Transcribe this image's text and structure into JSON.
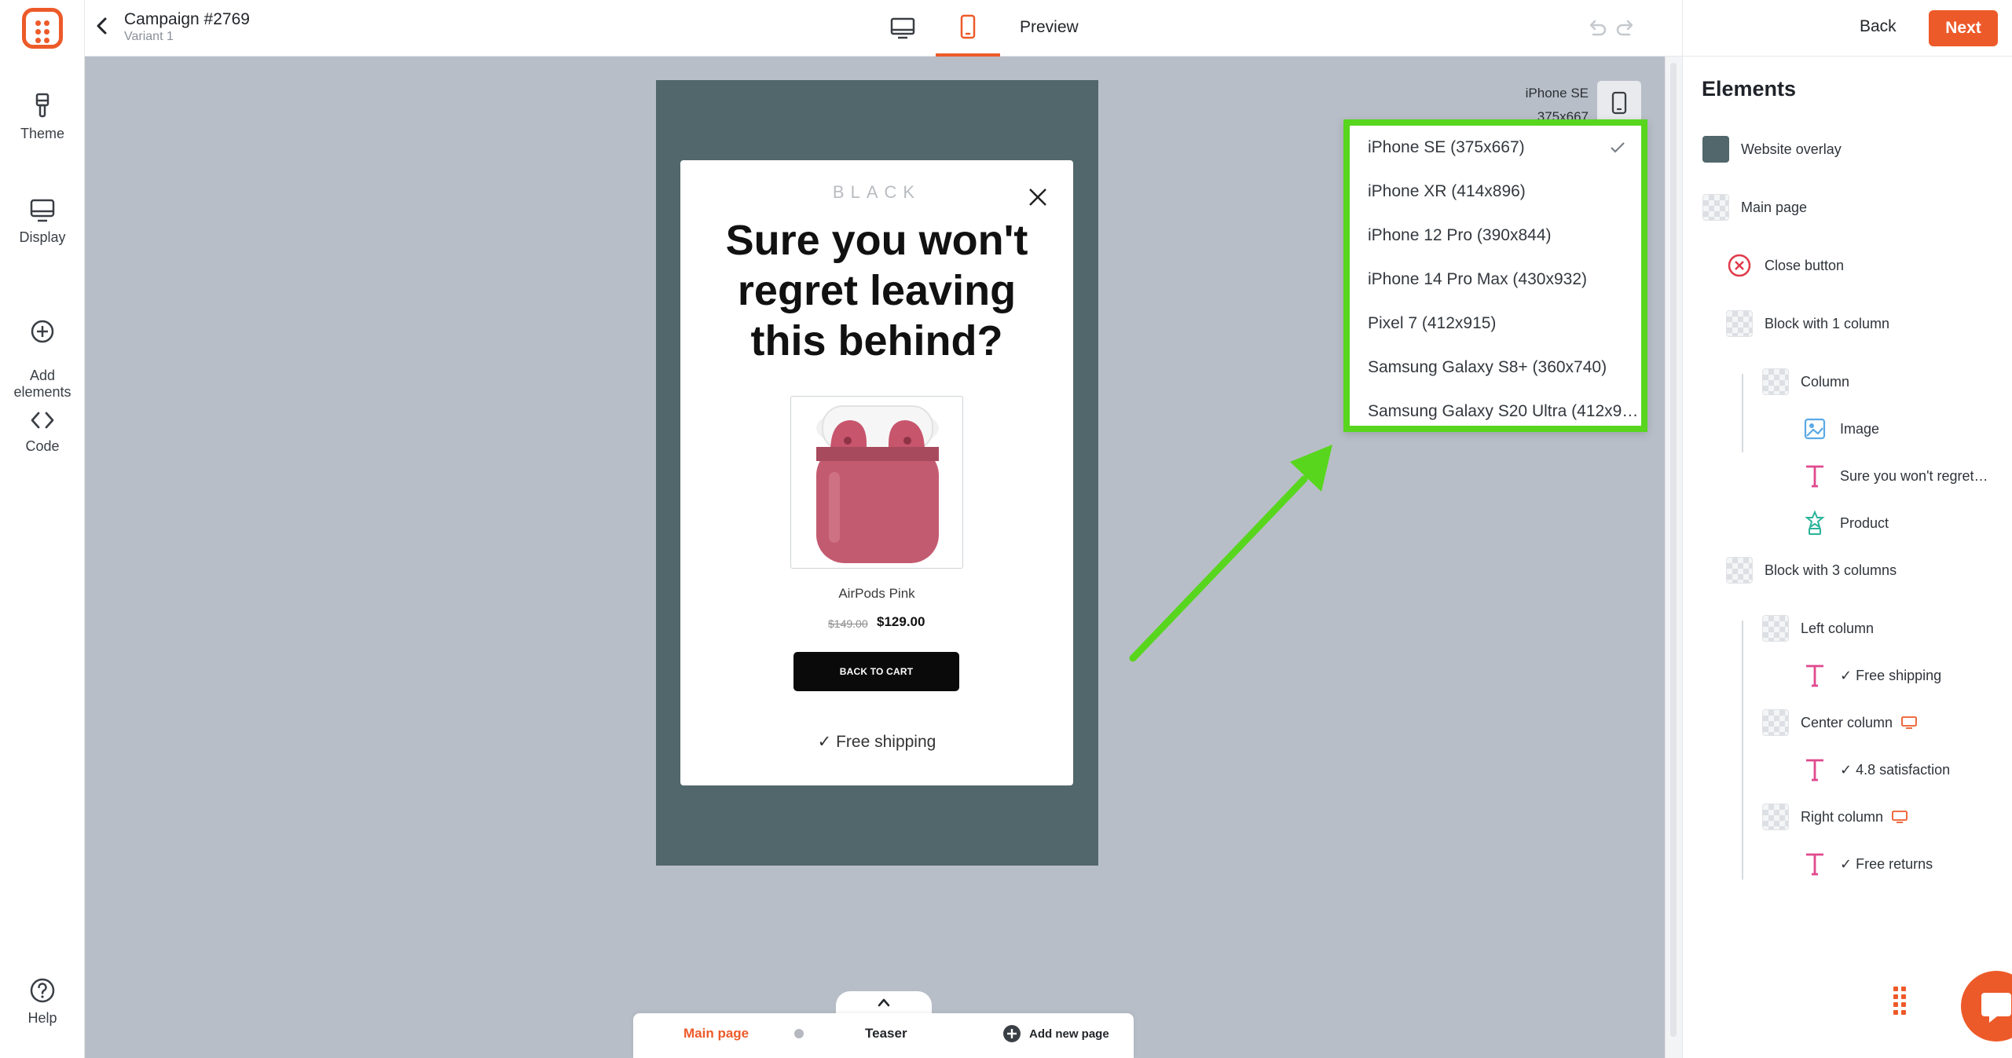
{
  "app": {
    "brand_color": "#ed5a29"
  },
  "sidebar": {
    "items": [
      {
        "label": "Theme",
        "icon": "brush-icon"
      },
      {
        "label": "Display",
        "icon": "monitor-icon"
      },
      {
        "label": "Add\nelements",
        "icon": "plus-circle-icon"
      },
      {
        "label": "Code",
        "icon": "code-icon"
      }
    ],
    "help_label": "Help"
  },
  "header": {
    "campaign_title": "Campaign #2769",
    "variant": "Variant 1",
    "preview_label": "Preview",
    "back_label": "Back",
    "next_label": "Next",
    "active_device": "mobile"
  },
  "canvas": {
    "overlay_color": "#51676b",
    "device_name": "iPhone SE",
    "device_size": "375x667",
    "popup": {
      "brand": "BLACK",
      "headline": "Sure you won't regret leaving this behind?",
      "product_name": "AirPods Pink",
      "price_old": "$149.00",
      "price_new": "$129.00",
      "cta_label": "BACK TO CART",
      "free_shipping": "✓ Free shipping"
    }
  },
  "device_dropdown": {
    "highlight_color": "#58d61e",
    "selected_index": 0,
    "options": [
      "iPhone SE (375x667)",
      "iPhone XR (414x896)",
      "iPhone 12 Pro (390x844)",
      "iPhone 14 Pro Max (430x932)",
      "Pixel 7 (412x915)",
      "Samsung Galaxy S8+ (360x740)",
      "Samsung Galaxy S20 Ultra (412x9…"
    ]
  },
  "page_tabs": {
    "main_page": "Main page",
    "teaser": "Teaser",
    "add_new_page": "Add new page"
  },
  "elements_panel": {
    "title": "Elements",
    "items": [
      {
        "label": "Website overlay",
        "icon": "overlay-swatch-icon"
      },
      {
        "label": "Main page",
        "icon": "checker-icon"
      },
      {
        "label": "Close button",
        "icon": "close-circle-icon"
      },
      {
        "label": "Block with 1 column",
        "icon": "checker-icon"
      },
      {
        "label": "Column",
        "icon": "checker-icon"
      },
      {
        "label": "Image",
        "icon": "image-icon"
      },
      {
        "label": "Sure you won't regret…",
        "icon": "text-icon"
      },
      {
        "label": "Product",
        "icon": "product-icon"
      },
      {
        "label": "Block with 3 columns",
        "icon": "checker-icon"
      },
      {
        "label": "Left column",
        "icon": "checker-icon"
      },
      {
        "label": "✓ Free shipping",
        "icon": "text-icon"
      },
      {
        "label": "Center column",
        "icon": "checker-icon"
      },
      {
        "label": "✓ 4.8 satisfaction",
        "icon": "text-icon"
      },
      {
        "label": "Right column",
        "icon": "checker-icon"
      },
      {
        "label": "✓ Free returns",
        "icon": "text-icon"
      }
    ]
  }
}
